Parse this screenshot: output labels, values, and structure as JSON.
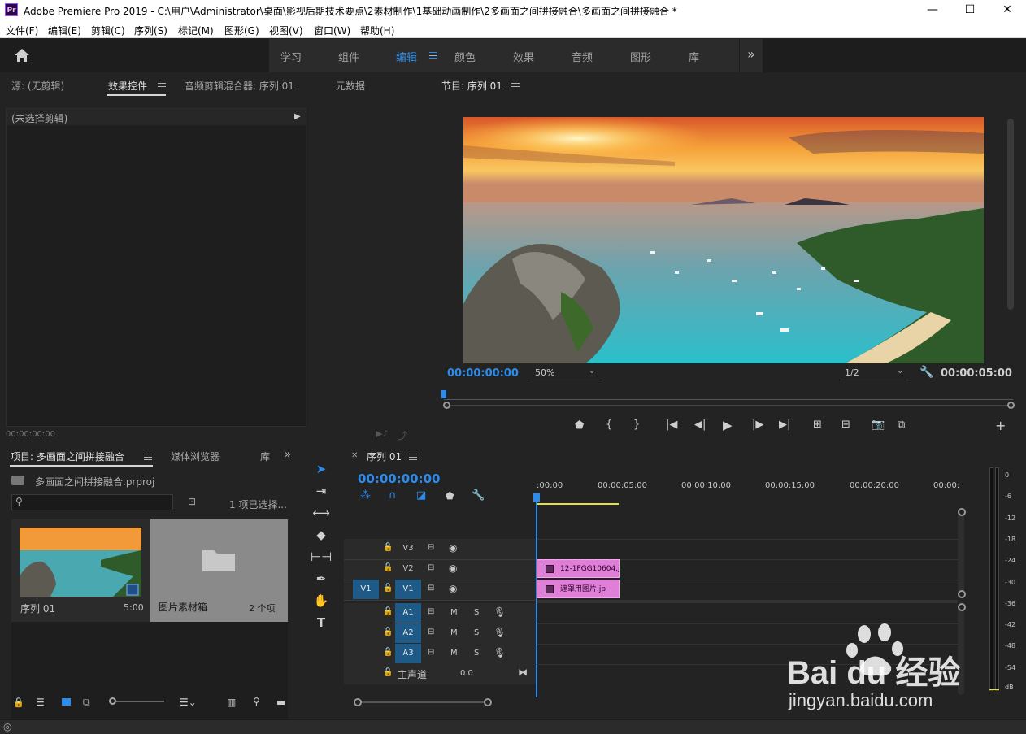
{
  "window": {
    "app_icon": "Pr",
    "title": "Adobe Premiere Pro 2019 - C:\\用户\\Administrator\\桌面\\影视后期技术要点\\2素材制作\\1基础动画制作\\2多画面之间拼接融合\\多画面之间拼接融合 *",
    "minimize": "—",
    "maximize": "☐",
    "close": "✕"
  },
  "menu": [
    "文件(F)",
    "编辑(E)",
    "剪辑(C)",
    "序列(S)",
    "标记(M)",
    "图形(G)",
    "视图(V)",
    "窗口(W)",
    "帮助(H)"
  ],
  "workspaces": {
    "tabs": [
      "学习",
      "组件",
      "编辑",
      "颜色",
      "效果",
      "音频",
      "图形",
      "库"
    ],
    "active": "编辑",
    "more": "»"
  },
  "source_panel": {
    "tabs": [
      "源: (无剪辑)",
      "效果控件",
      "音频剪辑混合器: 序列 01",
      "元数据"
    ],
    "active": "效果控件",
    "no_clip": "(未选择剪辑)",
    "timecode": "00:00:00:00"
  },
  "program_panel": {
    "title": "节目: 序列 01",
    "timecode": "00:00:00:00",
    "zoom": "50%",
    "resolution": "1/2",
    "duration": "00:00:05:00",
    "playhead_fraction": 0
  },
  "project_panel": {
    "tabs": [
      "项目: 多画面之间拼接融合",
      "媒体浏览器",
      "库"
    ],
    "active": "项目: 多画面之间拼接融合",
    "file": "多画面之间拼接融合.prproj",
    "selected": "1 项已选择...",
    "search_placeholder": "",
    "items": [
      {
        "name": "序列 01",
        "duration": "5:00"
      },
      {
        "name": "图片素材箱",
        "count": "2 个项"
      }
    ]
  },
  "timeline": {
    "tab": "序列 01",
    "timecode": "00:00:00:00",
    "ruler": [
      ":00:00",
      "00:00:05:00",
      "00:00:10:00",
      "00:00:15:00",
      "00:00:20:00",
      "00:00:"
    ],
    "video_tracks": [
      "V3",
      "V2",
      "V1"
    ],
    "audio_tracks": [
      "A1",
      "A2",
      "A3"
    ],
    "source_patch": "V1",
    "mute": "M",
    "solo": "S",
    "master_label": "主声道",
    "master_value": "0.0",
    "clips": [
      {
        "track": "V2",
        "name": "12-1FGG10604.jp"
      },
      {
        "track": "V1",
        "name": "遮罩用图片.jp"
      }
    ]
  },
  "vu_meter": [
    "0",
    "-6",
    "-12",
    "-18",
    "-24",
    "-30",
    "-36",
    "-42",
    "-48",
    "-54",
    "dB"
  ],
  "watermark": {
    "logo": "Bai du 经验",
    "url": "jingyan.baidu.com"
  },
  "colors": {
    "accent": "#2d8ceb",
    "clip": "#e07fd8",
    "panel": "#232323",
    "track_select": "#1e5a88"
  }
}
